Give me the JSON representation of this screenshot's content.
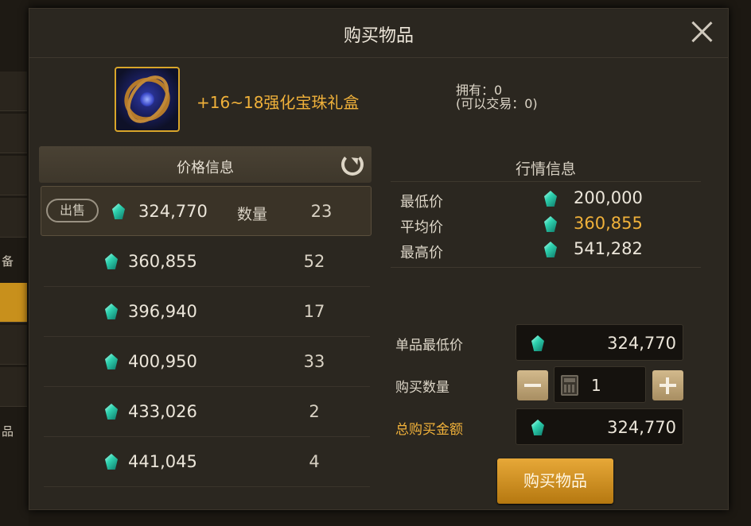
{
  "dialog": {
    "title": "购买物品"
  },
  "background": {
    "left_labels": [
      "备",
      "品"
    ]
  },
  "item": {
    "name": "+16~18强化宝珠礼盒",
    "owned": "拥有：0",
    "tradable": "(可以交易：0)"
  },
  "price_panel": {
    "header": "价格信息",
    "sell_label": "出售",
    "qty_label": "数量",
    "rows": [
      {
        "price": "324,770",
        "qty": "23"
      },
      {
        "price": "360,855",
        "qty": "52"
      },
      {
        "price": "396,940",
        "qty": "17"
      },
      {
        "price": "400,950",
        "qty": "33"
      },
      {
        "price": "433,026",
        "qty": "2"
      },
      {
        "price": "441,045",
        "qty": "4"
      }
    ]
  },
  "market": {
    "header": "行情信息",
    "min_label": "最低价",
    "min": "200,000",
    "avg_label": "平均价",
    "avg": "360,855",
    "max_label": "最高价",
    "max": "541,282"
  },
  "purchase": {
    "unit_label": "单品最低价",
    "unit_price": "324,770",
    "qty_label": "购买数量",
    "qty": "1",
    "total_label": "总购买金额",
    "total": "324,770",
    "buy_label": "购买物品"
  },
  "colors": {
    "accent_gold": "#f0b13a",
    "gem_teal": "#2fd3b0",
    "button_gold": "#e7a838"
  },
  "icons": [
    "close-icon",
    "refresh-icon",
    "gem-icon",
    "calculator-icon",
    "minus-icon",
    "plus-icon"
  ]
}
